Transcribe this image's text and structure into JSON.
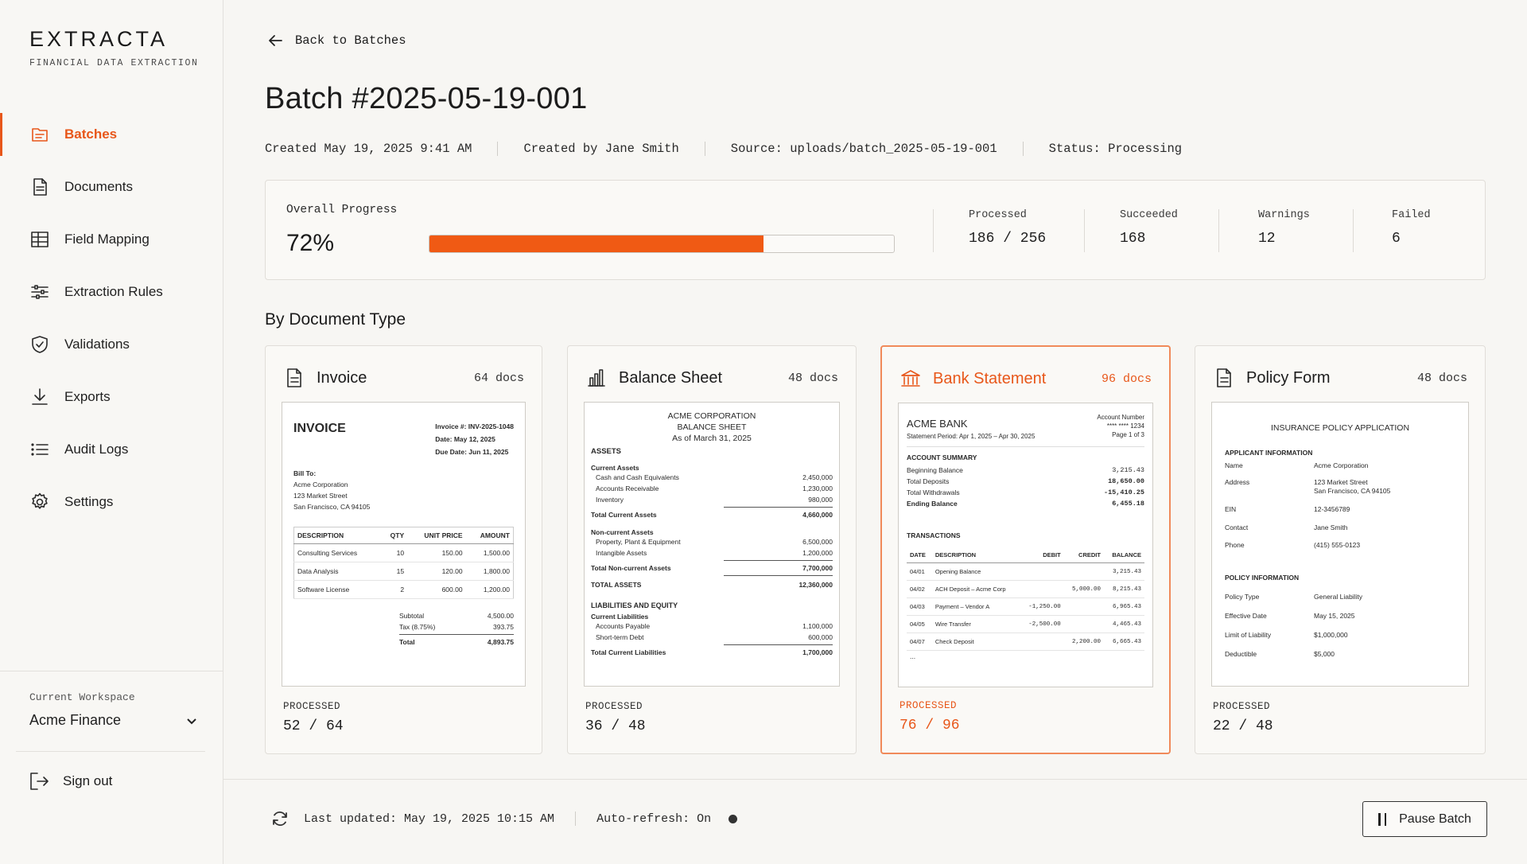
{
  "brand": {
    "name": "EXTRACTA",
    "tagline": "FINANCIAL DATA EXTRACTION"
  },
  "nav": [
    {
      "label": "Batches",
      "icon": "batches-icon",
      "active": true
    },
    {
      "label": "Documents",
      "icon": "document-icon",
      "active": false
    },
    {
      "label": "Field Mapping",
      "icon": "table-icon",
      "active": false
    },
    {
      "label": "Extraction Rules",
      "icon": "sliders-icon",
      "active": false
    },
    {
      "label": "Validations",
      "icon": "shield-check-icon",
      "active": false
    },
    {
      "label": "Exports",
      "icon": "download-icon",
      "active": false
    },
    {
      "label": "Audit Logs",
      "icon": "list-icon",
      "active": false
    },
    {
      "label": "Settings",
      "icon": "gear-icon",
      "active": false
    }
  ],
  "workspace": {
    "label": "Current Workspace",
    "value": "Acme Finance"
  },
  "signout": "Sign out",
  "back": "Back to Batches",
  "title": "Batch #2025-05-19-001",
  "meta": {
    "created": "Created May 19, 2025 9:41 AM",
    "created_by": "Created by Jane Smith",
    "source": "Source: uploads/batch_2025-05-19-001",
    "status": "Status: Processing"
  },
  "progress": {
    "label": "Overall Progress",
    "percent_text": "72%",
    "percent": 72,
    "stats": [
      {
        "label": "Processed",
        "value": "186 / 256"
      },
      {
        "label": "Succeeded",
        "value": "168"
      },
      {
        "label": "Warnings",
        "value": "12"
      },
      {
        "label": "Failed",
        "value": "6"
      }
    ]
  },
  "section_title": "By Document Type",
  "processed_label": "PROCESSED",
  "cards": {
    "invoice": {
      "title": "Invoice",
      "count": "64 docs",
      "processed": "52 / 64",
      "preview": {
        "heading": "INVOICE",
        "invoice_no": "Invoice #: INV-2025-1048",
        "date": "Date: May 12, 2025",
        "due": "Due Date: Jun 11, 2025",
        "bill_to": "Bill To:",
        "bill_lines": [
          "Acme Corporation",
          "123 Market Street",
          "San Francisco, CA 94105"
        ],
        "columns": [
          "DESCRIPTION",
          "QTY",
          "UNIT PRICE",
          "AMOUNT"
        ],
        "rows": [
          [
            "Consulting Services",
            "10",
            "150.00",
            "1,500.00"
          ],
          [
            "Data Analysis",
            "15",
            "120.00",
            "1,800.00"
          ],
          [
            "Software License",
            "2",
            "600.00",
            "1,200.00"
          ]
        ],
        "subtotal_label": "Subtotal",
        "subtotal": "4,500.00",
        "tax_label": "Tax (8.75%)",
        "tax": "393.75",
        "total_label": "Total",
        "total": "4,893.75"
      }
    },
    "balance": {
      "title": "Balance Sheet",
      "count": "48 docs",
      "processed": "36 / 48",
      "preview": {
        "company": "ACME CORPORATION",
        "doc": "BALANCE SHEET",
        "asof": "As of March 31, 2025",
        "assets": "ASSETS",
        "current_assets": "Current Assets",
        "ca_rows": [
          [
            "Cash and Cash Equivalents",
            "2,450,000"
          ],
          [
            "Accounts Receivable",
            "1,230,000"
          ],
          [
            "Inventory",
            "980,000"
          ]
        ],
        "total_ca": [
          "Total Current Assets",
          "4,660,000"
        ],
        "noncurrent": "Non-current Assets",
        "nca_rows": [
          [
            "Property, Plant & Equipment",
            "6,500,000"
          ],
          [
            "Intangible Assets",
            "1,200,000"
          ]
        ],
        "total_nca": [
          "Total Non-current Assets",
          "7,700,000"
        ],
        "total_assets": [
          "TOTAL ASSETS",
          "12,360,000"
        ],
        "liab": "LIABILITIES AND EQUITY",
        "current_liab": "Current Liabilities",
        "cl_rows": [
          [
            "Accounts Payable",
            "1,100,000"
          ],
          [
            "Short-term Debt",
            "600,000"
          ]
        ],
        "total_cl": [
          "Total Current Liabilities",
          "1,700,000"
        ]
      }
    },
    "bank": {
      "title": "Bank Statement",
      "count": "96 docs",
      "processed": "76 / 96",
      "preview": {
        "bank": "ACME BANK",
        "acct_label": "Account Number",
        "acct": "**** **** 1234",
        "period": "Statement Period: Apr 1, 2025 – Apr 30, 2025",
        "page": "Page 1 of 3",
        "summary": "ACCOUNT SUMMARY",
        "sum_rows": [
          [
            "Beginning Balance",
            "3,215.43"
          ],
          [
            "Total Deposits",
            "18,650.00"
          ],
          [
            "Total Withdrawals",
            "-15,410.25"
          ],
          [
            "Ending Balance",
            "6,455.18"
          ]
        ],
        "transactions": "TRANSACTIONS",
        "columns": [
          "DATE",
          "DESCRIPTION",
          "DEBIT",
          "CREDIT",
          "BALANCE"
        ],
        "rows": [
          [
            "04/01",
            "Opening Balance",
            "",
            "",
            "3,215.43"
          ],
          [
            "04/02",
            "ACH Deposit – Acme Corp",
            "",
            "5,000.00",
            "8,215.43"
          ],
          [
            "04/03",
            "Payment – Vendor A",
            "-1,250.00",
            "",
            "6,965.43"
          ],
          [
            "04/05",
            "Wire Transfer",
            "-2,500.00",
            "",
            "4,465.43"
          ],
          [
            "04/07",
            "Check Deposit",
            "",
            "2,200.00",
            "6,665.43"
          ]
        ],
        "more": "..."
      }
    },
    "policy": {
      "title": "Policy Form",
      "count": "48 docs",
      "processed": "22 / 48",
      "preview": {
        "heading": "INSURANCE POLICY APPLICATION",
        "applicant": "APPLICANT INFORMATION",
        "app_rows": [
          [
            "Name",
            "Acme Corporation"
          ],
          [
            "Address",
            "123 Market Street"
          ],
          [
            "",
            "San Francisco, CA 94105"
          ],
          [
            "EIN",
            "12-3456789"
          ],
          [
            "Contact",
            "Jane Smith"
          ],
          [
            "Phone",
            "(415) 555-0123"
          ]
        ],
        "policy": "POLICY INFORMATION",
        "pol_rows": [
          [
            "Policy Type",
            "General Liability"
          ],
          [
            "Effective Date",
            "May 15, 2025"
          ],
          [
            "Limit of Liability",
            "$1,000,000"
          ],
          [
            "Deductible",
            "$5,000"
          ]
        ]
      }
    }
  },
  "footer": {
    "last_updated": "Last updated: May 19, 2025 10:15 AM",
    "auto_refresh": "Auto-refresh: On",
    "pause": "Pause Batch"
  },
  "colors": {
    "accent": "#e8571a",
    "progress": "#f05a14"
  }
}
